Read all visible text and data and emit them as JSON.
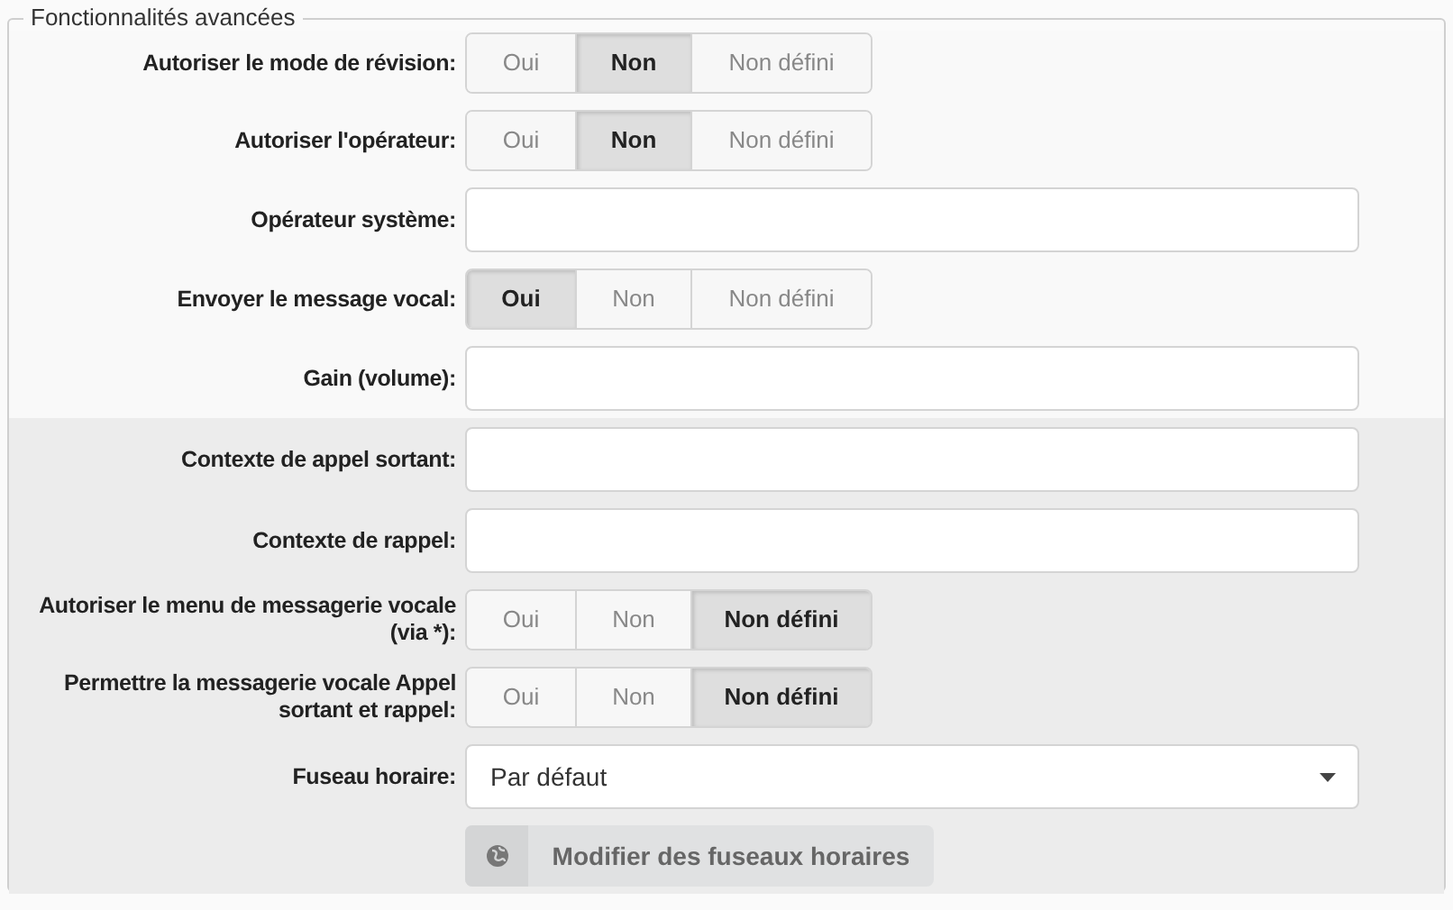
{
  "section": {
    "title": "Fonctionnalités avancées"
  },
  "groups": [
    {
      "highlighted": false,
      "rows": [
        {
          "kind": "toggle",
          "label": "Autoriser le mode de révision:",
          "options": [
            {
              "label": "Oui",
              "selected": false
            },
            {
              "label": "Non",
              "selected": true
            },
            {
              "label": "Non défini",
              "selected": false
            }
          ]
        },
        {
          "kind": "toggle",
          "label": "Autoriser l'opérateur:",
          "options": [
            {
              "label": "Oui",
              "selected": false
            },
            {
              "label": "Non",
              "selected": true
            },
            {
              "label": "Non défini",
              "selected": false
            }
          ]
        },
        {
          "kind": "text",
          "label": "Opérateur système:"
        },
        {
          "kind": "toggle",
          "label": "Envoyer le message vocal:",
          "options": [
            {
              "label": "Oui",
              "selected": true
            },
            {
              "label": "Non",
              "selected": false
            },
            {
              "label": "Non défini",
              "selected": false
            }
          ]
        },
        {
          "kind": "text",
          "label": "Gain (volume):"
        }
      ]
    },
    {
      "highlighted": true,
      "rows": [
        {
          "kind": "text",
          "label": "Contexte de appel sortant:"
        },
        {
          "kind": "text",
          "label": "Contexte de rappel:"
        },
        {
          "kind": "toggle",
          "label": "Autoriser le menu de messagerie vocale (via *):",
          "options": [
            {
              "label": "Oui",
              "selected": false
            },
            {
              "label": "Non",
              "selected": false
            },
            {
              "label": "Non défini",
              "selected": true
            }
          ]
        },
        {
          "kind": "toggle",
          "label": "Permettre la messagerie vocale Appel sortant et rappel:",
          "options": [
            {
              "label": "Oui",
              "selected": false
            },
            {
              "label": "Non",
              "selected": false
            },
            {
              "label": "Non défini",
              "selected": true
            }
          ]
        },
        {
          "kind": "select",
          "label": "Fuseau horaire:",
          "value": "Par défaut"
        },
        {
          "kind": "button",
          "text": "Modifier des fuseaux horaires"
        }
      ]
    }
  ]
}
